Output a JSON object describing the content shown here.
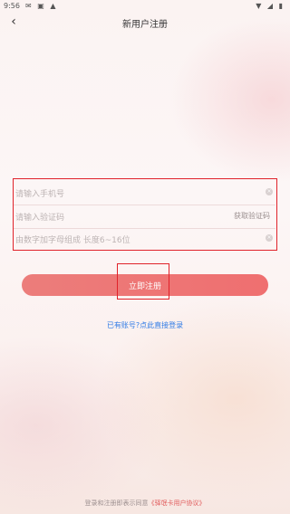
{
  "status_bar": {
    "time": "9:56",
    "left_icons": "✉ ▣ ▲",
    "right_icons": "▼ ◢ ▮"
  },
  "nav": {
    "back_icon": "‹",
    "title": "新用户注册"
  },
  "form": {
    "phone_placeholder": "请输入手机号",
    "code_placeholder": "请输入验证码",
    "get_code_label": "获取验证码",
    "password_placeholder": "由数字加字母组成 长度6~16位",
    "clear_icon": "×"
  },
  "actions": {
    "register_label": "立即注册",
    "login_link": "已有账号?点此直接登录"
  },
  "footer": {
    "agreement_prefix": "登录和注册即表示同意",
    "agreement_link": "《驿氓卡用户协议》"
  },
  "colors": {
    "accent": "#ef7575",
    "link": "#2f7be6",
    "highlight_box": "#e0222a"
  }
}
